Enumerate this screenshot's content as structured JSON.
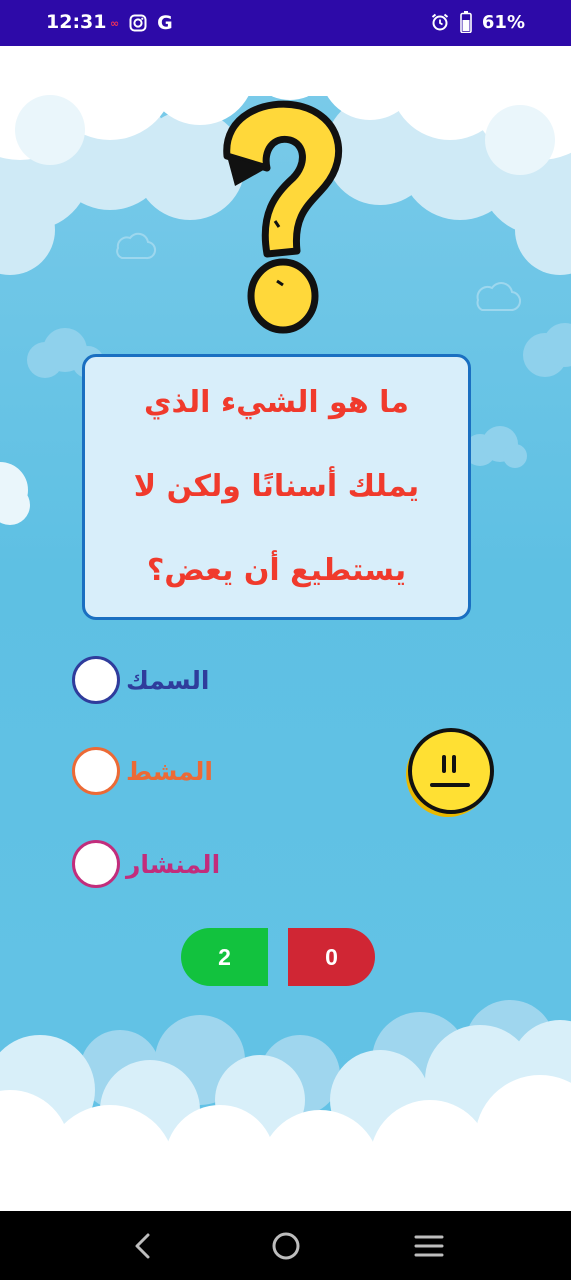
{
  "status_bar": {
    "time": "12:31",
    "left_icons": [
      "notification-icon",
      "instagram-icon",
      "google-icon"
    ],
    "right_icons": [
      "alarm-icon",
      "battery-icon"
    ],
    "battery": "61%"
  },
  "question": {
    "lines": [
      "ما هو الشيء الذي",
      "يملك أسنانًا ولكن لا",
      "يستطيع أن يعض؟"
    ]
  },
  "options": [
    {
      "label": "السمك",
      "color": "#2f3c9c"
    },
    {
      "label": "المشط",
      "color": "#ec6a36"
    },
    {
      "label": "المنشار",
      "color": "#c22d7c"
    }
  ],
  "scores": {
    "correct": "2",
    "wrong": "0",
    "correct_color": "#12c23e",
    "wrong_color": "#d02634"
  },
  "nav_bar": {
    "icons": [
      "back-icon",
      "home-icon",
      "menu-icon"
    ]
  }
}
